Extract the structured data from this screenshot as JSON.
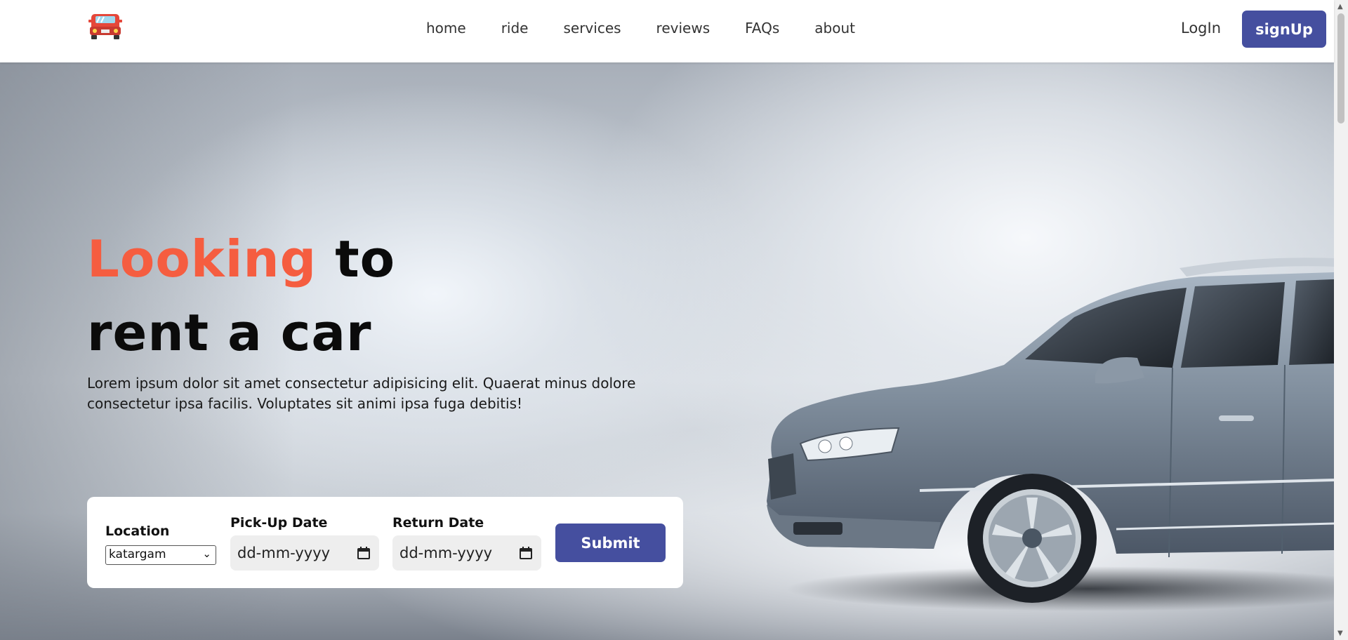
{
  "header": {
    "logo": "red-car-logo",
    "nav": [
      {
        "label": "home"
      },
      {
        "label": "ride"
      },
      {
        "label": "services"
      },
      {
        "label": "reviews"
      },
      {
        "label": "FAQs"
      },
      {
        "label": "about"
      }
    ],
    "login_label": "LogIn",
    "signup_label": "signUp"
  },
  "hero": {
    "headline_accent": "Looking",
    "headline_rest_1": " to",
    "headline_line_2": "rent a car",
    "description": "Lorem ipsum dolor sit amet consectetur adipisicing elit. Quaerat minus dolore consectetur ipsa facilis. Voluptates sit animi ipsa fuga debitis!",
    "image": "silver-station-wagon-car"
  },
  "booking": {
    "location_label": "Location",
    "location_value": "katargam",
    "pickup_label": "Pick-Up Date",
    "pickup_placeholder": "dd-mm-yyyy",
    "return_label": "Return Date",
    "return_placeholder": "dd-mm-yyyy",
    "submit_label": "Submit"
  },
  "colors": {
    "accent": "#f55d40",
    "brand": "#454f9f",
    "text": "#0b0b0b"
  }
}
